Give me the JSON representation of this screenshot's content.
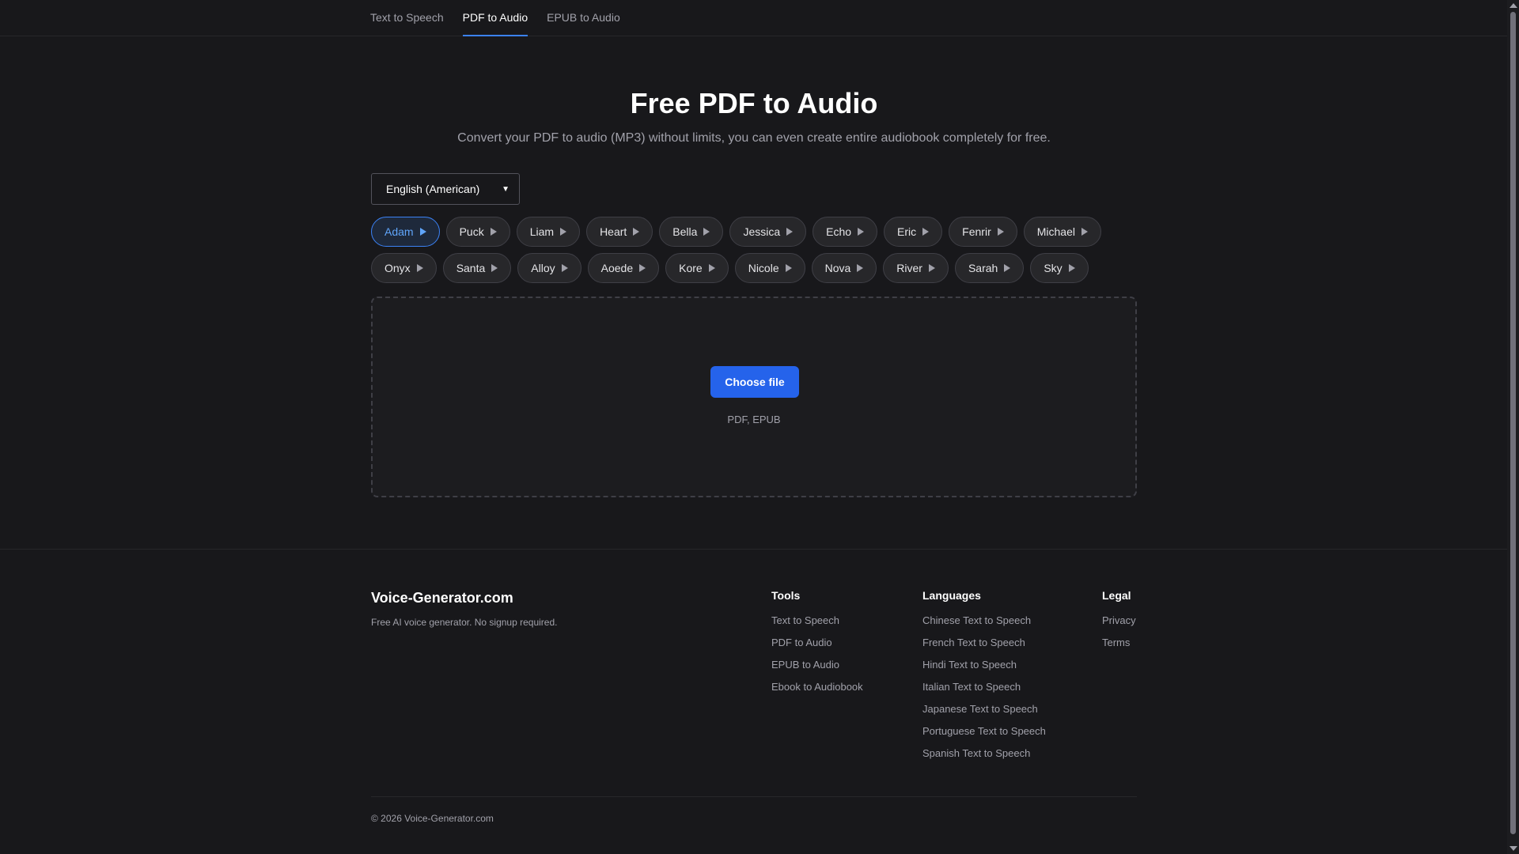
{
  "nav": {
    "tabs": [
      {
        "label": "Text to Speech",
        "active": false
      },
      {
        "label": "PDF to Audio",
        "active": true
      },
      {
        "label": "EPUB to Audio",
        "active": false
      }
    ]
  },
  "hero": {
    "title": "Free PDF to Audio",
    "subtitle": "Convert your PDF to audio (MP3) without limits, you can even create entire audiobook completely for free."
  },
  "language_select": {
    "selected": "English (American)"
  },
  "voices": {
    "selected": "Adam",
    "row1": [
      "Adam",
      "Puck",
      "Liam",
      "Heart",
      "Bella",
      "Jessica",
      "Echo",
      "Eric",
      "Fenrir",
      "Michael"
    ],
    "row2": [
      "Onyx",
      "Santa",
      "Alloy",
      "Aoede",
      "Kore",
      "Nicole",
      "Nova",
      "River",
      "Sarah",
      "Sky"
    ]
  },
  "upload": {
    "button_label": "Choose file",
    "formats": "PDF, EPUB"
  },
  "footer": {
    "brand": "Voice-Generator.com",
    "tagline": "Free AI voice generator. No signup required.",
    "tools": {
      "heading": "Tools",
      "links": [
        "Text to Speech",
        "PDF to Audio",
        "EPUB to Audio",
        "Ebook to Audiobook"
      ]
    },
    "languages": {
      "heading": "Languages",
      "links": [
        "Chinese Text to Speech",
        "French Text to Speech",
        "Hindi Text to Speech",
        "Italian Text to Speech",
        "Japanese Text to Speech",
        "Portuguese Text to Speech",
        "Spanish Text to Speech"
      ]
    },
    "legal": {
      "heading": "Legal",
      "links": [
        "Privacy",
        "Terms"
      ]
    },
    "copyright": "© 2026 Voice-Generator.com"
  },
  "colors": {
    "accent": "#3b82f6",
    "button": "#2563eb",
    "background": "#18181b"
  }
}
